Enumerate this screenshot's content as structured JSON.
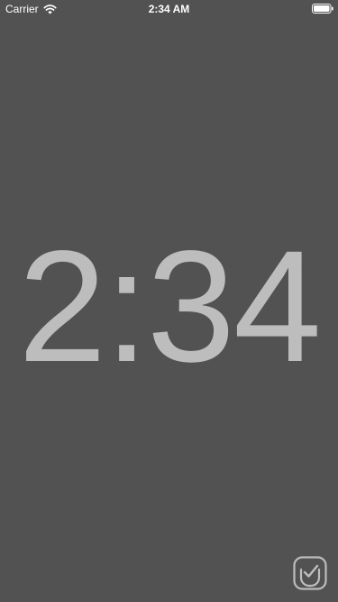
{
  "status_bar": {
    "carrier": "Carrier",
    "time": "2:34 AM",
    "icons": {
      "signal": "wifi-icon",
      "battery": "battery-icon"
    }
  },
  "clock": {
    "display": "2:34"
  },
  "action_button": {
    "icon": "app-check-icon"
  },
  "colors": {
    "background": "#525252",
    "clock_text": "#bdbdbd",
    "status_text": "#ffffff",
    "button_stroke": "#bdbdbd"
  }
}
